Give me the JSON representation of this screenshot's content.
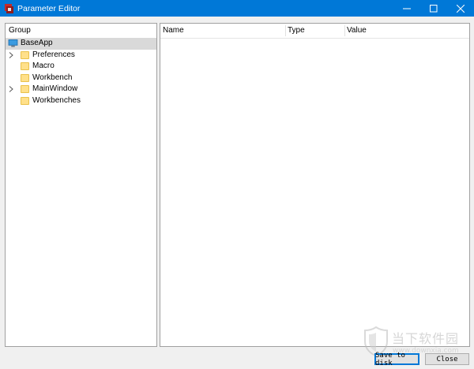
{
  "window": {
    "title": "Parameter Editor",
    "controls": {
      "minimize": "minimize",
      "maximize": "maximize",
      "close": "close"
    }
  },
  "group_tree": {
    "header": "Group",
    "items": [
      {
        "label": "BaseApp",
        "icon": "computer-icon",
        "expandable": false,
        "selected": true,
        "level": 0
      },
      {
        "label": "Preferences",
        "icon": "folder-icon",
        "expandable": true,
        "selected": false,
        "level": 1
      },
      {
        "label": "Macro",
        "icon": "folder-icon",
        "expandable": false,
        "selected": false,
        "level": 1
      },
      {
        "label": "Workbench",
        "icon": "folder-icon",
        "expandable": false,
        "selected": false,
        "level": 1
      },
      {
        "label": "MainWindow",
        "icon": "folder-icon",
        "expandable": true,
        "selected": false,
        "level": 1
      },
      {
        "label": "Workbenches",
        "icon": "folder-icon",
        "expandable": false,
        "selected": false,
        "level": 1
      }
    ]
  },
  "parameter_table": {
    "columns": [
      "Name",
      "Type",
      "Value"
    ],
    "rows": []
  },
  "buttons": {
    "save": "Save to disk",
    "close": "Close"
  },
  "watermark": {
    "text": "当下软件园",
    "subtext": "www.downxia.com"
  },
  "colors": {
    "titlebar": "#0078d7",
    "selection": "#d9d9d9",
    "folder": "#ffe08a"
  }
}
